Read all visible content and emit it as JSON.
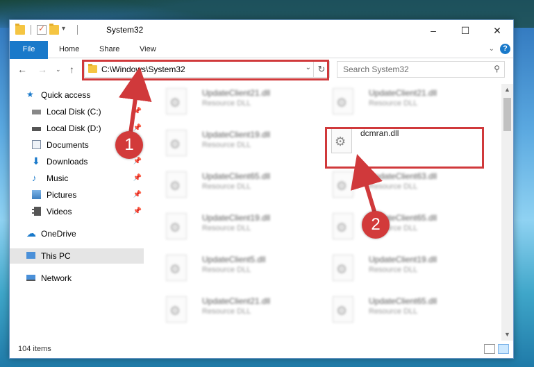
{
  "window": {
    "title": "System32"
  },
  "ribbon": {
    "tabs": [
      "File",
      "Home",
      "Share",
      "View"
    ]
  },
  "address_bar": {
    "path": "C:\\Windows\\System32",
    "search_placeholder": "Search System32"
  },
  "sidebar": {
    "items": [
      {
        "label": "Quick access",
        "icon": "star-icon",
        "pinned": false
      },
      {
        "label": "Local Disk (C:)",
        "icon": "drive-icon",
        "pinned": true
      },
      {
        "label": "Local Disk (D:)",
        "icon": "drive-icon",
        "pinned": true
      },
      {
        "label": "Documents",
        "icon": "documents-icon",
        "pinned": true
      },
      {
        "label": "Downloads",
        "icon": "download-arrow-icon",
        "pinned": true
      },
      {
        "label": "Music",
        "icon": "music-note-icon",
        "pinned": true
      },
      {
        "label": "Pictures",
        "icon": "pictures-icon",
        "pinned": true
      },
      {
        "label": "Videos",
        "icon": "film-icon",
        "pinned": true
      },
      {
        "label": "OneDrive",
        "icon": "cloud-icon",
        "pinned": false
      },
      {
        "label": "This PC",
        "icon": "computer-icon",
        "pinned": false,
        "selected": true
      },
      {
        "label": "Network",
        "icon": "network-icon",
        "pinned": false
      }
    ]
  },
  "files": {
    "left": [
      {
        "name": "UpdateClient21.dll",
        "type": "Resource DLL"
      },
      {
        "name": "UpdateClient19.dll",
        "type": "Resource DLL"
      },
      {
        "name": "UpdateClient65.dll",
        "type": "Resource DLL"
      },
      {
        "name": "UpdateClient19.dll",
        "type": "Resource DLL"
      },
      {
        "name": "UpdateClient5.dll",
        "type": "Resource DLL"
      },
      {
        "name": "UpdateClient21.dll",
        "type": "Resource DLL"
      }
    ],
    "right": [
      {
        "name": "UpdateClient21.dll",
        "type": "Resource DLL"
      },
      {
        "name": "dcmran.dll",
        "type": ""
      },
      {
        "name": "UpdateClient63.dll",
        "type": "Resource DLL"
      },
      {
        "name": "UpdateClient65.dll",
        "type": "Resource DLL"
      },
      {
        "name": "UpdateClient19.dll",
        "type": "Resource DLL"
      },
      {
        "name": "UpdateClient65.dll",
        "type": "Resource DLL"
      }
    ]
  },
  "status": {
    "item_count": "104 items"
  },
  "annotations": {
    "badge1": "1",
    "badge2": "2",
    "highlight_color": "#d0393b"
  }
}
